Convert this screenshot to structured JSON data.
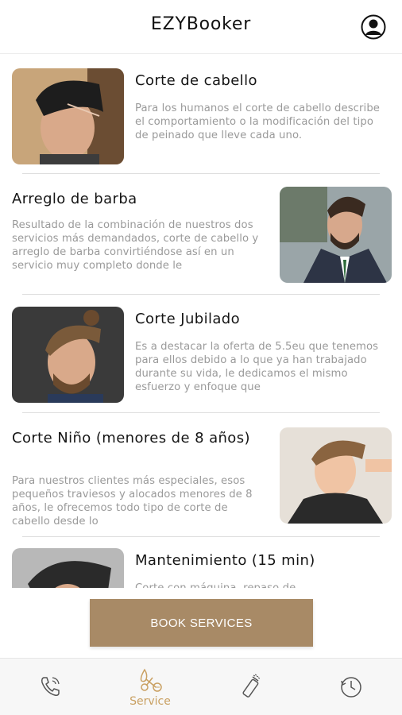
{
  "app": {
    "title": "EZYBooker"
  },
  "header": {
    "profile_icon": "user-circle-icon"
  },
  "services": [
    {
      "title": "Corte de cabello",
      "description": "Para los humanos el corte de cabello describe el comportamiento o la modificación del tipo de peinado que lleve cada uno."
    },
    {
      "title": "Arreglo de barba",
      "description": "Resultado de la combinación de nuestros dos servicios más demandados, corte de cabello y arreglo de barba convirtiéndose así en un servicio muy completo donde le"
    },
    {
      "title": "Corte Jubilado",
      "description": "Es a destacar la oferta de 5.5eu que tenemos para ellos debido a lo que ya han trabajado durante su vida, le dedicamos el mismo esfuerzo y enfoque que"
    },
    {
      "title": "Corte Niño (menores de 8 años)",
      "description": "Para nuestros clientes más especiales, esos pequeños traviesos y alocados menores de 8 años, le ofrecemos todo tipo de corte de cabello desde lo"
    },
    {
      "title": "Mantenimiento (15 min)",
      "description": "Corte con máquina, repaso de"
    }
  ],
  "book_button": {
    "label": "BOOK SERVICES"
  },
  "nav": {
    "tabs": [
      {
        "icon": "phone-icon",
        "label": ""
      },
      {
        "icon": "scissors-service-icon",
        "label": "Service"
      },
      {
        "icon": "hair-trimmer-icon",
        "label": ""
      },
      {
        "icon": "clock-history-icon",
        "label": ""
      }
    ]
  },
  "colors": {
    "accent": "#a88a66",
    "active_tab": "#c9a062",
    "inactive_icon": "#555555",
    "description_text": "#9a9a9a"
  }
}
